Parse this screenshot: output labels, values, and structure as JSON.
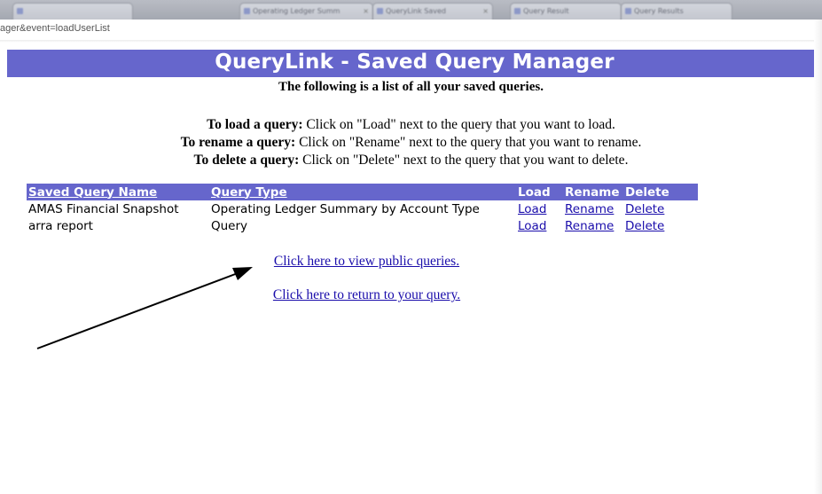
{
  "browser": {
    "tabs": [
      "",
      "Operating Ledger Summ",
      "QueryLink Saved",
      "Query Result",
      "Query Results"
    ],
    "url": "ager&event=loadUserList"
  },
  "page": {
    "title": "QueryLink - Saved Query Manager",
    "subtitle": "The following is a list of all your saved queries.",
    "instructions": [
      {
        "bold": "To load a query:",
        "text": " Click on \"Load\" next to the query that you want to load."
      },
      {
        "bold": "To rename a query:",
        "text": " Click on \"Rename\" next to the query that you want to rename."
      },
      {
        "bold": "To delete a query:",
        "text": " Click on \"Delete\" next to the query that you want to delete."
      }
    ],
    "table": {
      "headers": {
        "name": "Saved Query Name",
        "type": "Query Type",
        "load": "Load",
        "rename": "Rename",
        "delete": "Delete"
      },
      "rows": [
        {
          "name": "AMAS Financial Snapshot",
          "type": "Operating Ledger Summary by Account Type",
          "load": "Load",
          "rename": "Rename",
          "delete": "Delete"
        },
        {
          "name": "arra report",
          "type": "Query",
          "load": "Load",
          "rename": "Rename",
          "delete": "Delete"
        }
      ]
    },
    "public_link": "Click here to view public queries.",
    "return_link": "Click here to return to your query."
  },
  "colors": {
    "banner": "#6666cc",
    "link": "#1a0dab",
    "arrow": "#000000"
  }
}
